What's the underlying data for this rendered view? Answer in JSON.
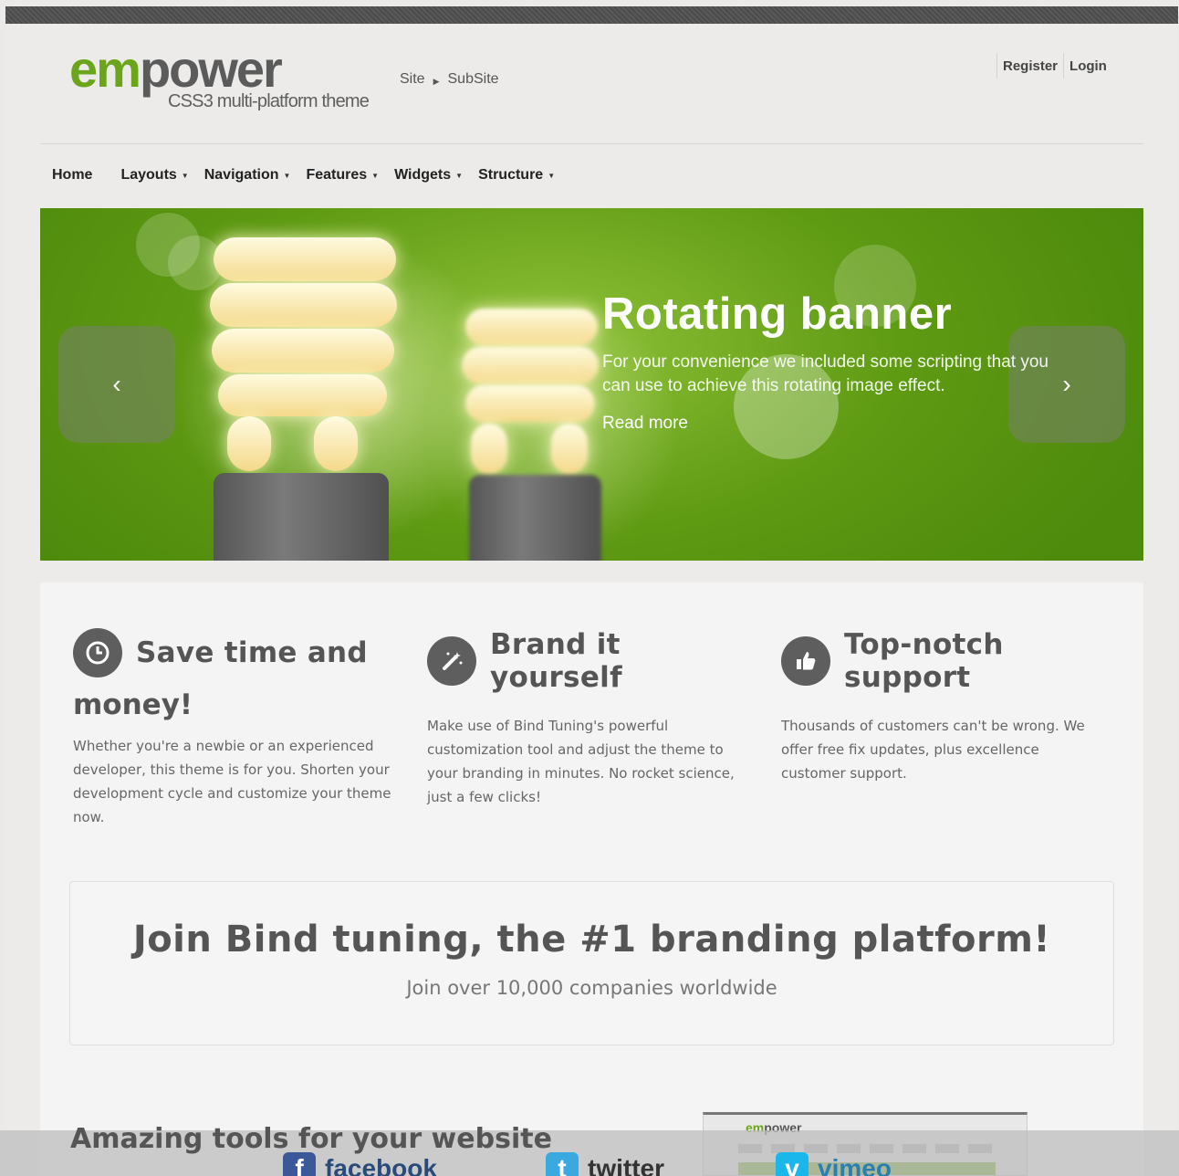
{
  "header": {
    "logo_em": "em",
    "logo_power": "power",
    "tagline": "CSS3 multi-platform theme",
    "breadcrumb": [
      "Site",
      "SubSite"
    ],
    "register": "Register",
    "login": "Login"
  },
  "nav": {
    "items": [
      "Home",
      "Layouts",
      "Navigation",
      "Features",
      "Widgets",
      "Structure"
    ]
  },
  "banner": {
    "title": "Rotating banner",
    "text": "For your convenience we included some scripting that you can use to achieve this rotating image effect.",
    "read_more": "Read more",
    "prev": "‹",
    "next": "›"
  },
  "features": [
    {
      "title_line1": "Save time and",
      "title_line2": "money!",
      "icon": "clock-icon",
      "text": "Whether you're a newbie or an experienced developer, this theme is for you. Shorten your development cycle and customize your theme now."
    },
    {
      "title_line1": "Brand it yourself",
      "icon": "magic-wand-icon",
      "text": "Make use of Bind Tuning's powerful customization tool and adjust the theme to your branding in minutes. No rocket science, just a few clicks!"
    },
    {
      "title_line1": "Top-notch support",
      "icon": "thumbs-up-icon",
      "text": "Thousands of customers can't be wrong. We offer free fix updates, plus excellence customer support."
    }
  ],
  "cta": {
    "title": "Join Bind tuning, the #1 branding platform!",
    "subtitle": "Join over 10,000 companies worldwide"
  },
  "tools": {
    "title": "Amazing tools for your website",
    "facebook": "facebook",
    "twitter": "twitter",
    "vimeo": "vimeo"
  },
  "colors": {
    "brand_green": "#6aa51c",
    "dark_gray": "#5e5e5e"
  }
}
